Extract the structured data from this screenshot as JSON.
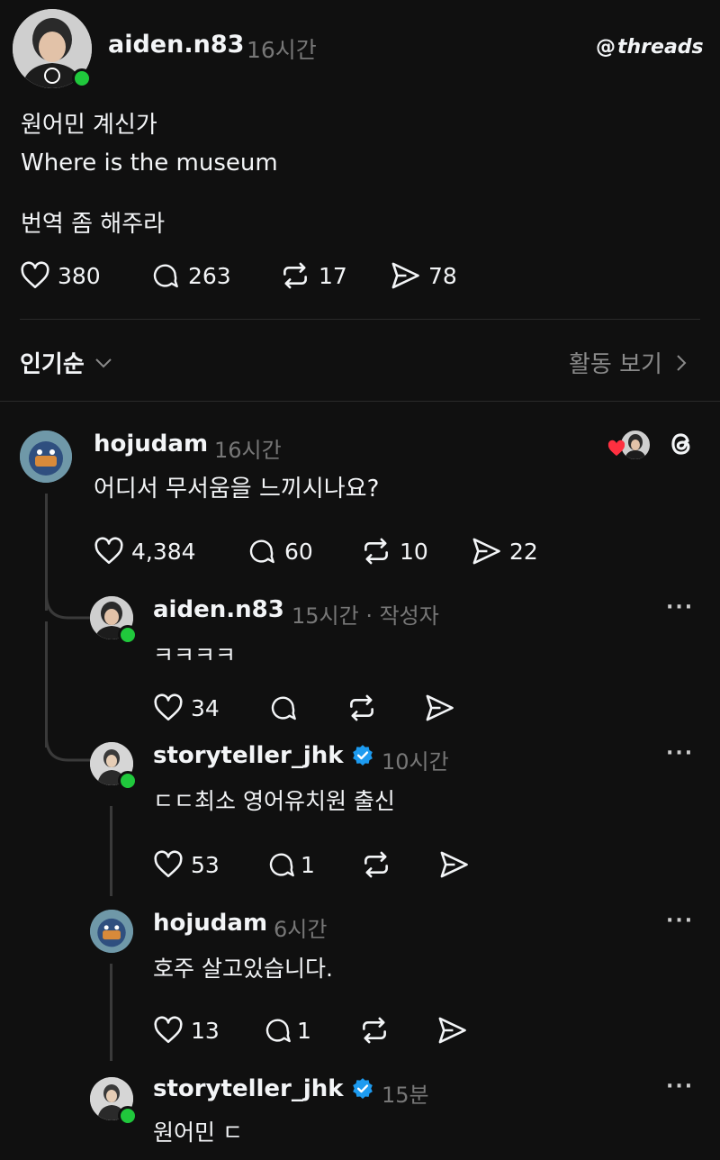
{
  "post": {
    "author": "aiden.n83",
    "time": "16시간",
    "brand": "threads",
    "lines": [
      "원어민 계신가",
      "Where is the museum",
      "번역 좀 해주라"
    ],
    "likes": "380",
    "replies": "263",
    "reposts": "17",
    "shares": "78"
  },
  "sort_bar": {
    "sort_label": "인기순",
    "activity_label": "활동 보기"
  },
  "comments": [
    {
      "author": "hojudam",
      "time": "16시간",
      "verified": false,
      "text": "어디서 무서움을 느끼시나요?",
      "likes": "4,384",
      "replies": "60",
      "reposts": "10",
      "shares": "22"
    },
    {
      "author": "aiden.n83",
      "time": "15시간 · 작성자",
      "verified": false,
      "text": "ㅋㅋㅋㅋ",
      "likes": "34",
      "replies": ""
    },
    {
      "author": "storyteller_jhk",
      "time": "10시간",
      "verified": true,
      "text": "ㄷㄷ최소 영어유치원 출신",
      "likes": "53",
      "replies": "1"
    },
    {
      "author": "hojudam",
      "time": "6시간",
      "verified": false,
      "text": "호주 살고있습니다.",
      "likes": "13",
      "replies": "1"
    },
    {
      "author": "storyteller_jhk",
      "time": "15분",
      "verified": true,
      "text": "원어민 ㄷ"
    }
  ],
  "colors": {
    "background": "#101010",
    "text": "#f3f5f7",
    "muted": "#777777",
    "online": "#20c83c",
    "verified": "#1d9bf0",
    "heart": "#ff3040"
  },
  "icons": [
    "heart-icon",
    "comment-icon",
    "repost-icon",
    "share-icon",
    "threads-logo-icon",
    "chevron-down-icon",
    "chevron-right-icon",
    "more-icon",
    "verified-badge-icon"
  ]
}
